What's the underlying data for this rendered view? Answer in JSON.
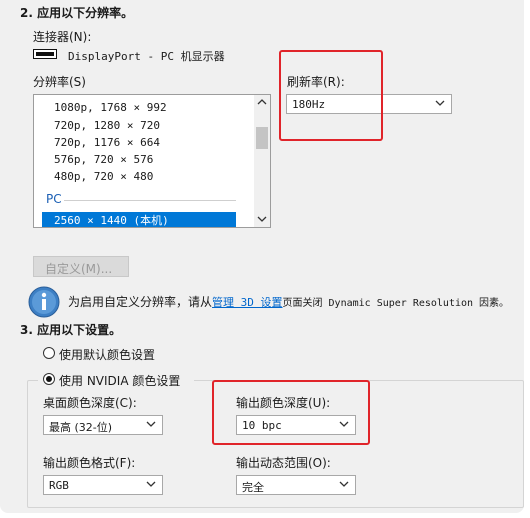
{
  "section2": {
    "title": "2. 应用以下分辨率。",
    "connector_label": "连接器(N):",
    "connector_value": "DisplayPort - PC 机显示器",
    "resolution_label": "分辨率(S)",
    "resolutions": [
      "1080p, 1768 × 992",
      "720p, 1280 × 720",
      "720p, 1176 × 664",
      "576p, 720 × 576",
      "480p, 720 × 480"
    ],
    "group_label": "PC",
    "selected_resolution": "2560 × 1440 (本机)",
    "refresh_label": "刷新率(R):",
    "refresh_value": "180Hz",
    "custom_button": "自定义(M)...",
    "info_text_before": "为启用自定义分辨率，请从",
    "info_link": "管理 3D 设置",
    "info_text_after": "页面关闭 Dynamic Super Resolution 因素。"
  },
  "section3": {
    "title": "3. 应用以下设置。",
    "radio_default": "使用默认颜色设置",
    "radio_nvidia": "使用 NVIDIA 颜色设置",
    "desktop_depth_label": "桌面颜色深度(C):",
    "desktop_depth_value": "最高 (32-位)",
    "output_depth_label": "输出颜色深度(U):",
    "output_depth_value": "10 bpc",
    "output_format_label": "输出颜色格式(F):",
    "output_format_value": "RGB",
    "output_range_label": "输出动态范围(O):",
    "output_range_value": "完全"
  },
  "colors": {
    "highlight": "#0078d7",
    "annotation": "#e0242a",
    "link": "#0066cc"
  },
  "icons": [
    "display-connector-icon",
    "info-icon",
    "chevron-down-icon",
    "chevron-up-icon"
  ]
}
